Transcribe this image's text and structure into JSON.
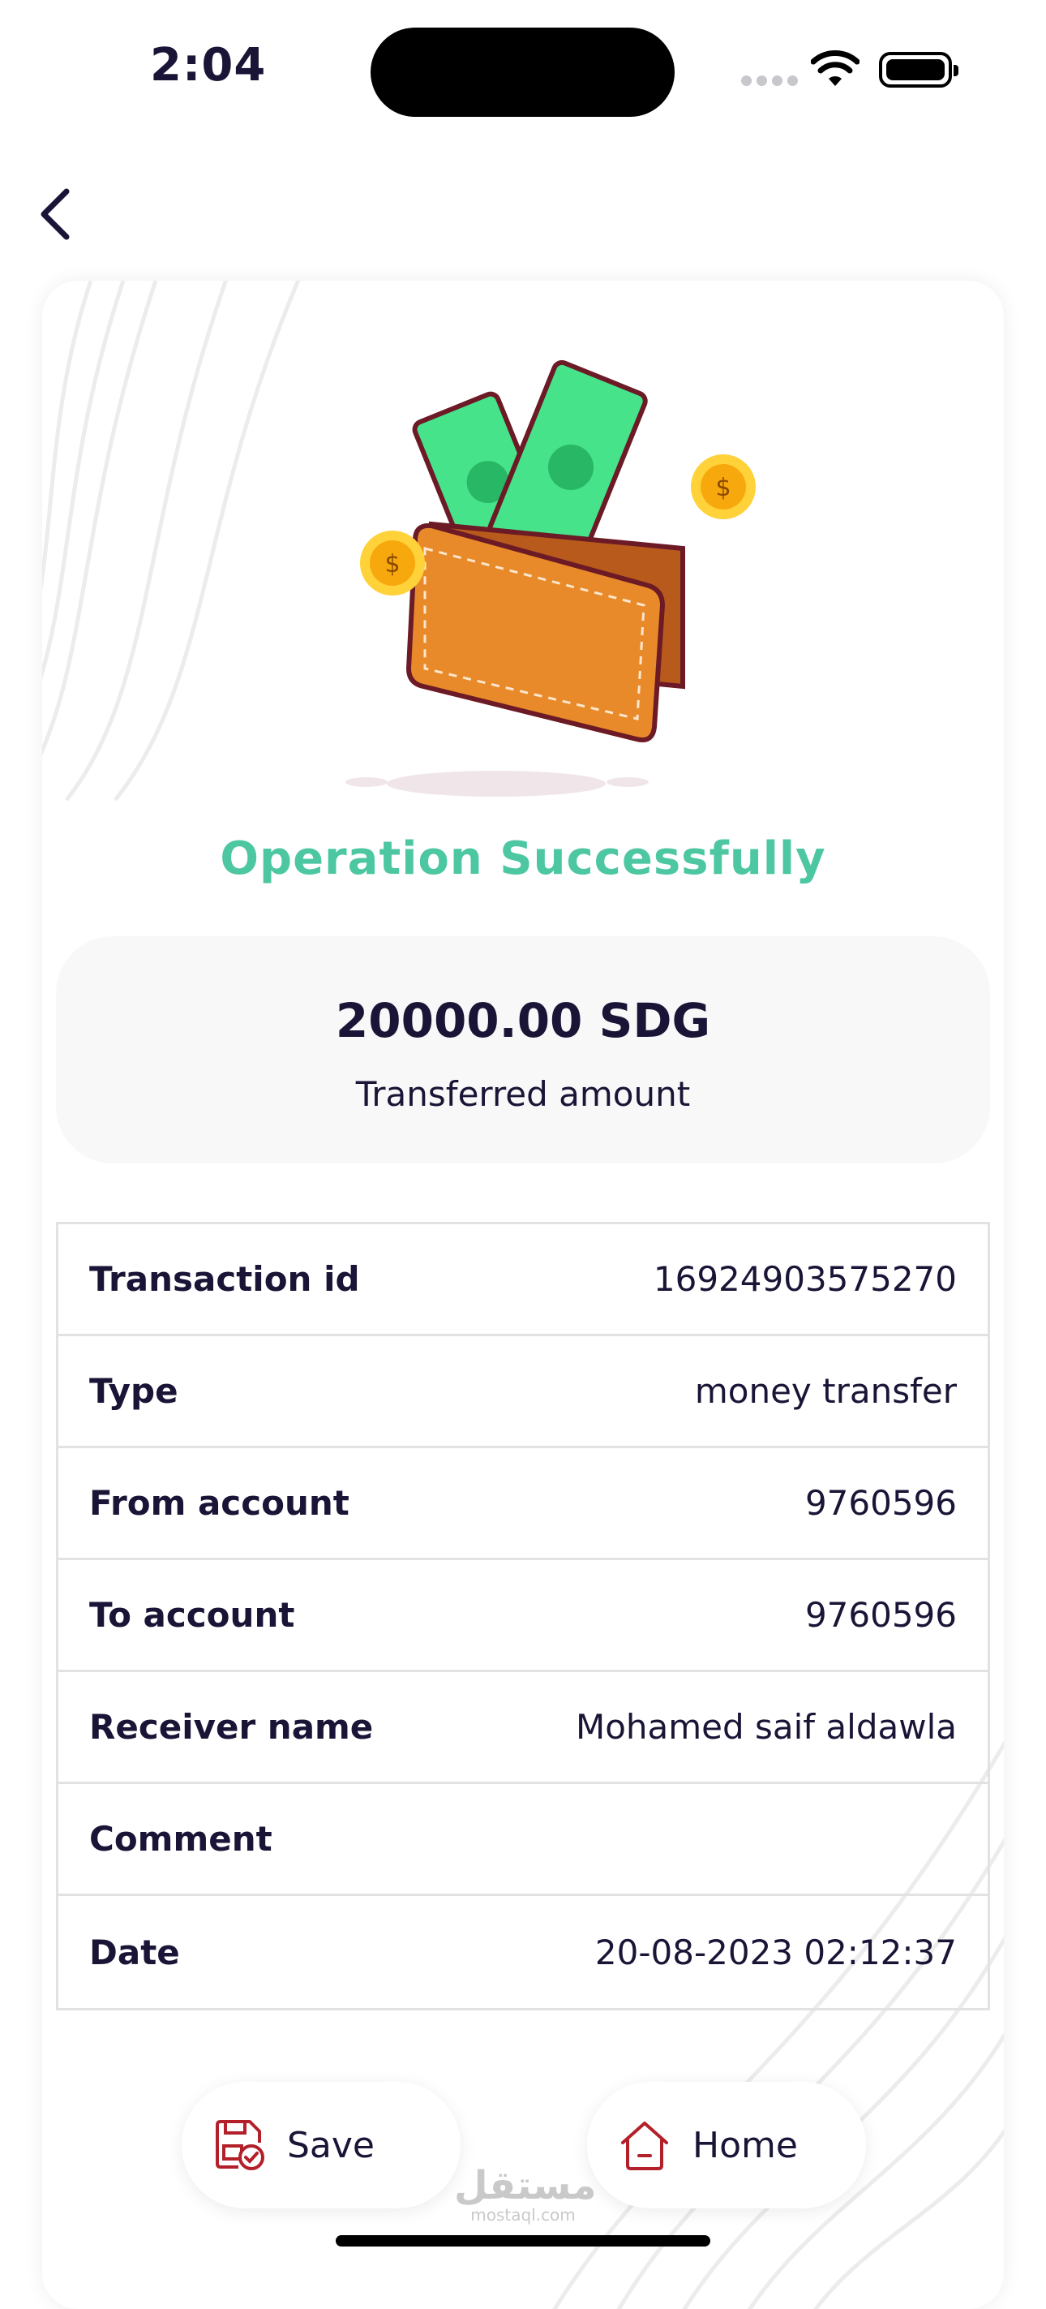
{
  "status_bar": {
    "time": "2:04"
  },
  "nav": {
    "back_icon": "chevron-left-icon"
  },
  "result": {
    "title": "Operation Successfully",
    "amount": "20000.00 SDG",
    "amount_label": "Transferred amount"
  },
  "details": {
    "rows": [
      {
        "label": "Transaction id",
        "value": "16924903575270"
      },
      {
        "label": "Type",
        "value": "money transfer"
      },
      {
        "label": "From account",
        "value": "9760596"
      },
      {
        "label": "To account",
        "value": "9760596"
      },
      {
        "label": "Receiver name",
        "value": "Mohamed saif aldawla"
      },
      {
        "label": "Comment",
        "value": ""
      },
      {
        "label": "Date",
        "value": "20-08-2023 02:12:37"
      }
    ]
  },
  "actions": {
    "save_label": "Save",
    "save_icon": "save-check-icon",
    "home_label": "Home",
    "home_icon": "home-icon"
  },
  "watermark": {
    "arabic": "مستقل",
    "latin": "mostaql.com"
  },
  "colors": {
    "accent_green": "#4cc7a1",
    "text_dark": "#1a1436",
    "icon_red": "#b3202a"
  }
}
